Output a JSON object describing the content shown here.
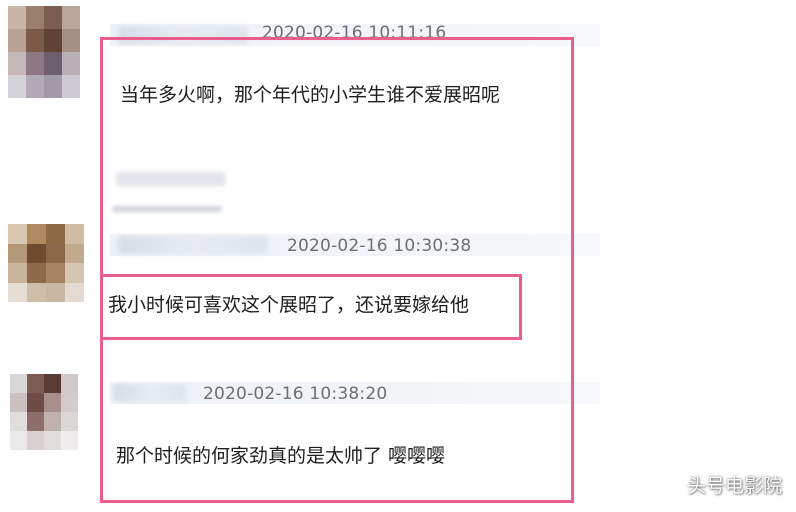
{
  "comments": [
    {
      "timestamp": "2020-02-16 10:11:16",
      "text": "当年多火啊，那个年代的小学生谁不爱展昭呢"
    },
    {
      "timestamp": "2020-02-16 10:30:38",
      "text": "我小时候可喜欢这个展昭了，还说要嫁给他"
    },
    {
      "timestamp": "2020-02-16 10:38:20",
      "text": "那个时候的何家劲真的是太帅了 嘤嘤嘤"
    }
  ],
  "watermark": "头号电影院",
  "colors": {
    "highlight": "#ea5e8b",
    "header_strip": "#eef1f6",
    "timestamp": "#6f6f6f"
  },
  "avatars": [
    {
      "name": "avatar-1",
      "pixels": [
        "#c9b4a6",
        "#9b7f6c",
        "#7a5e4f",
        "#b9a69a",
        "#b8a294",
        "#7b5a47",
        "#5e4334",
        "#a39185",
        "#c3b7b8",
        "#8f7883",
        "#6e5d6c",
        "#b9b0b6",
        "#d5d2d8",
        "#b1a9b4",
        "#a39aa8",
        "#cfcad2"
      ]
    },
    {
      "name": "avatar-2",
      "pixels": [
        "#d8c6b0",
        "#b08a5e",
        "#8c6a46",
        "#d0bca5",
        "#b3987a",
        "#6f4c2e",
        "#8a6848",
        "#c1a98e",
        "#cbb69d",
        "#8f6a4a",
        "#a48463",
        "#d6c5b2",
        "#e6ddd4",
        "#cdbda9",
        "#c8b7a3",
        "#e3dad1"
      ]
    },
    {
      "name": "avatar-3",
      "pixels": [
        "#d8d6d6",
        "#7c5b52",
        "#5a3c34",
        "#cfc9c9",
        "#cbbfbf",
        "#6f4c45",
        "#a98f8c",
        "#d4cccc",
        "#e2dddd",
        "#8d6e6a",
        "#c0b0ae",
        "#dcd7d7",
        "#ebe9e9",
        "#d7d0cf",
        "#e0dcdc",
        "#eeecec"
      ]
    }
  ]
}
